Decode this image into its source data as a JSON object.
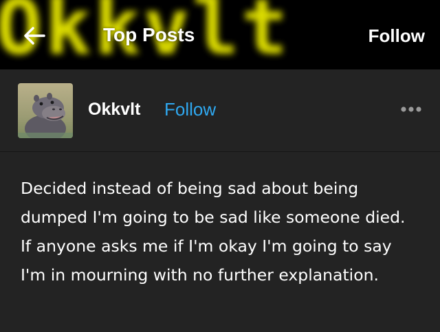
{
  "header": {
    "banner_text": "Okkvlt",
    "title": "Top Posts",
    "follow_label": "Follow",
    "back_icon": "arrow-left-icon",
    "banner_color": "#e8e800"
  },
  "post": {
    "author": "Okkvlt",
    "follow_label": "Follow",
    "follow_color": "#2fa8f0",
    "more_icon": "more-dots-icon",
    "avatar_icon": "hippo-avatar",
    "text": "Decided instead of being sad about being dumped I'm going to be sad like someone died. If anyone asks me if I'm okay I'm going to say I'm in mourning with no further explanation."
  }
}
